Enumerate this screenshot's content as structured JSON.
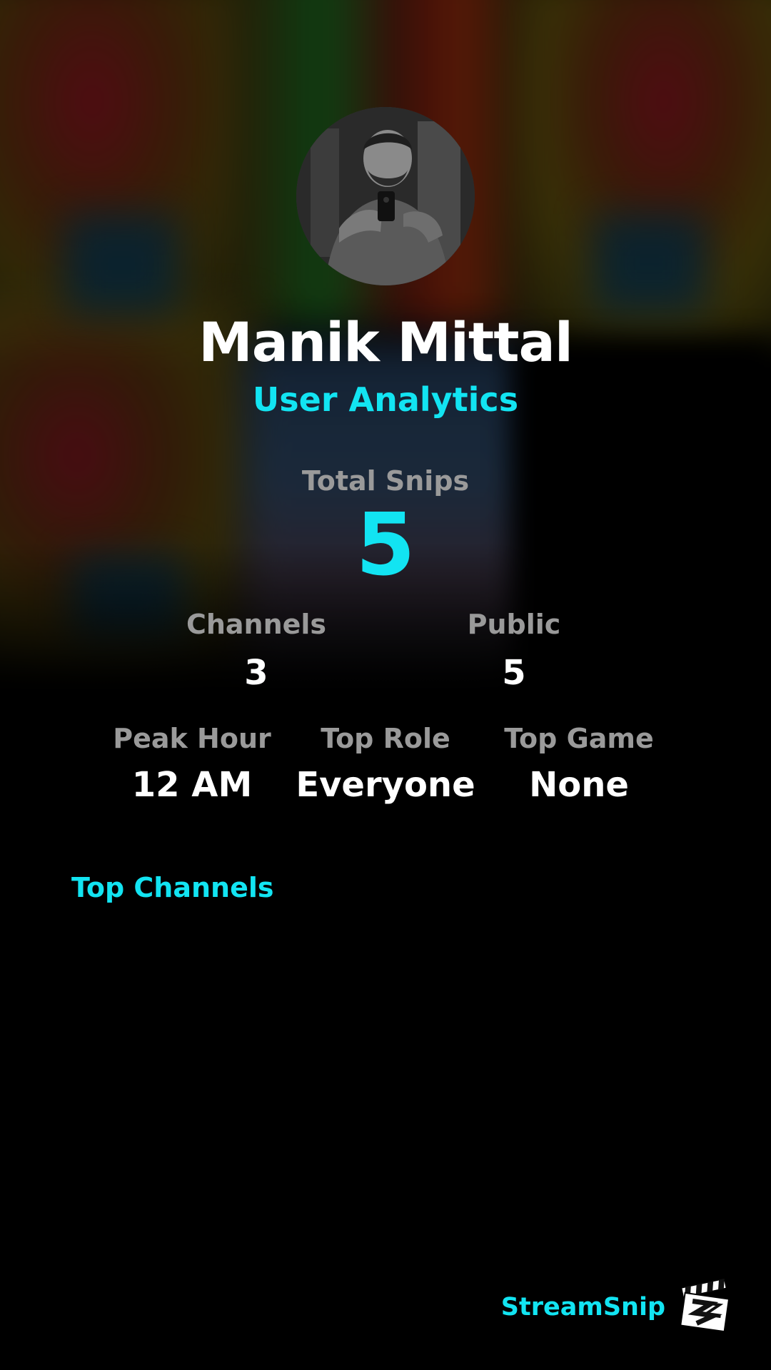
{
  "profile": {
    "name": "Manik Mittal",
    "subtitle": "User Analytics",
    "avatar_icon": "user-photo-avatar"
  },
  "stats": {
    "total_snips": {
      "label": "Total Snips",
      "value": "5"
    },
    "channels": {
      "label": "Channels",
      "value": "3"
    },
    "public": {
      "label": "Public",
      "value": "5"
    },
    "peak_hour": {
      "label": "Peak Hour",
      "value": "12 AM"
    },
    "top_role": {
      "label": "Top Role",
      "value": "Everyone"
    },
    "top_game": {
      "label": "Top Game",
      "value": "None"
    }
  },
  "top_channels": {
    "title": "Top Channels",
    "items": []
  },
  "brand": {
    "name": "StreamSnip",
    "logo_icon": "clapperboard-icon"
  },
  "colors": {
    "accent": "#12e4f2",
    "label": "#9a9a9a",
    "value": "#ffffff",
    "background": "#000000"
  }
}
